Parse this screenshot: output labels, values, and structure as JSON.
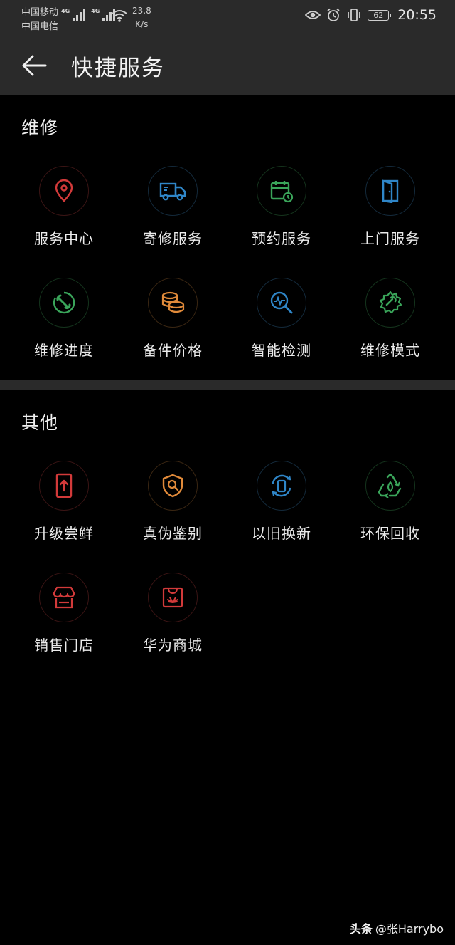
{
  "status_bar": {
    "carrier1": "中国移动",
    "carrier2": "中国电信",
    "net1": "4G",
    "net2": "4G",
    "speed_value": "23.8",
    "speed_unit": "K/s",
    "battery": "62",
    "time": "20:55",
    "icons": [
      "eye-comfort-icon",
      "alarm-icon",
      "vibrate-icon",
      "battery-icon"
    ]
  },
  "appbar": {
    "title": "快捷服务",
    "back_icon": "back-arrow-icon"
  },
  "sections": [
    {
      "title": "维修",
      "items": [
        {
          "label": "服务中心",
          "icon": "location-pin-icon",
          "color": "#d23a3a"
        },
        {
          "label": "寄修服务",
          "icon": "delivery-truck-icon",
          "color": "#2f86c8"
        },
        {
          "label": "预约服务",
          "icon": "calendar-clock-icon",
          "color": "#3aa55a"
        },
        {
          "label": "上门服务",
          "icon": "door-icon",
          "color": "#2f86c8"
        },
        {
          "label": "维修进度",
          "icon": "wrench-progress-icon",
          "color": "#3aa55a"
        },
        {
          "label": "备件价格",
          "icon": "coins-icon",
          "color": "#e08a3a"
        },
        {
          "label": "智能检测",
          "icon": "diagnostic-search-icon",
          "color": "#2f86c8"
        },
        {
          "label": "维修模式",
          "icon": "gear-wrench-icon",
          "color": "#3aa55a"
        }
      ]
    },
    {
      "title": "其他",
      "items": [
        {
          "label": "升级尝鲜",
          "icon": "phone-upgrade-icon",
          "color": "#d23a3a"
        },
        {
          "label": "真伪鉴别",
          "icon": "shield-search-icon",
          "color": "#e08a3a"
        },
        {
          "label": "以旧换新",
          "icon": "trade-in-icon",
          "color": "#2f86c8"
        },
        {
          "label": "环保回收",
          "icon": "recycle-icon",
          "color": "#3aa55a"
        },
        {
          "label": "销售门店",
          "icon": "store-icon",
          "color": "#d23a3a"
        },
        {
          "label": "华为商城",
          "icon": "huawei-mall-icon",
          "color": "#d23a3a"
        }
      ]
    }
  ],
  "watermark": {
    "brand": "头条",
    "handle": "@张Harrybo"
  }
}
